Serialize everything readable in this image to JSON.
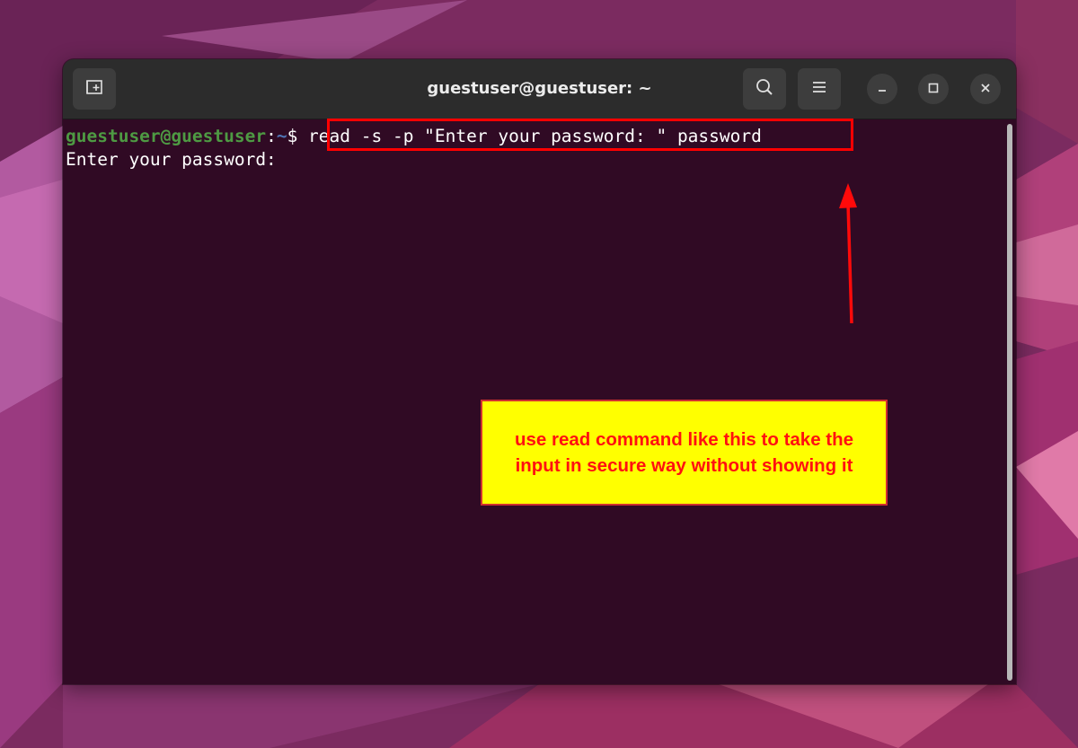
{
  "window": {
    "title": "guestuser@guestuser: ~"
  },
  "titlebar": {
    "new_tab_icon": "new-tab-icon",
    "search_icon": "search-icon",
    "menu_icon": "hamburger-menu-icon",
    "minimize_icon": "minimize-icon",
    "maximize_icon": "maximize-icon",
    "close_icon": "close-icon"
  },
  "terminal": {
    "prompt_user": "guestuser@guestuser",
    "prompt_sep": ":",
    "prompt_path": "~",
    "prompt_symbol": "$ ",
    "command": "read -s -p \"Enter your password: \" password",
    "output_line": "Enter your password: "
  },
  "annotation": {
    "note_text": "use read command like this to take the input in secure way without showing it",
    "highlight_color": "#ff0000",
    "note_background": "#ffff00"
  },
  "colors": {
    "terminal_bg": "#300a24",
    "prompt_user": "#4e9a43",
    "prompt_path": "#4f74b4"
  }
}
